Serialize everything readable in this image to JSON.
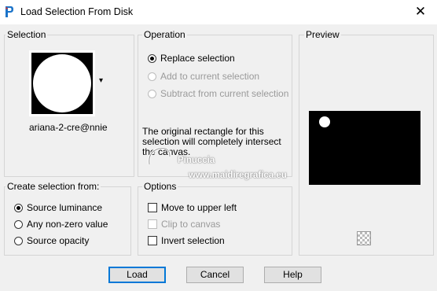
{
  "window": {
    "title": "Load Selection From Disk",
    "close_glyph": "✕"
  },
  "selection": {
    "label": "Selection",
    "filename": "ariana-2-cre@nnie",
    "dropdown_arrow": "▾"
  },
  "operation": {
    "label": "Operation",
    "options": [
      {
        "label": "Replace selection",
        "checked": true,
        "enabled": true
      },
      {
        "label": "Add to current selection",
        "checked": false,
        "enabled": false
      },
      {
        "label": "Subtract from current selection",
        "checked": false,
        "enabled": false
      }
    ],
    "description": "The original rectangle for this selection will completely intersect the canvas."
  },
  "preview": {
    "label": "Preview"
  },
  "create_from": {
    "label": "Create selection from:",
    "options": [
      {
        "label": "Source luminance",
        "checked": true
      },
      {
        "label": "Any non-zero value",
        "checked": false
      },
      {
        "label": "Source opacity",
        "checked": false
      }
    ]
  },
  "options": {
    "label": "Options",
    "items": [
      {
        "label": "Move to upper left",
        "checked": false,
        "enabled": true
      },
      {
        "label": "Clip to canvas",
        "checked": false,
        "enabled": false
      },
      {
        "label": "Invert selection",
        "checked": false,
        "enabled": true
      }
    ]
  },
  "watermark": {
    "line1": "Pinuccia",
    "line2": "www.maidiregrafica.eu"
  },
  "buttons": {
    "load": "Load",
    "cancel": "Cancel",
    "help": "Help"
  }
}
